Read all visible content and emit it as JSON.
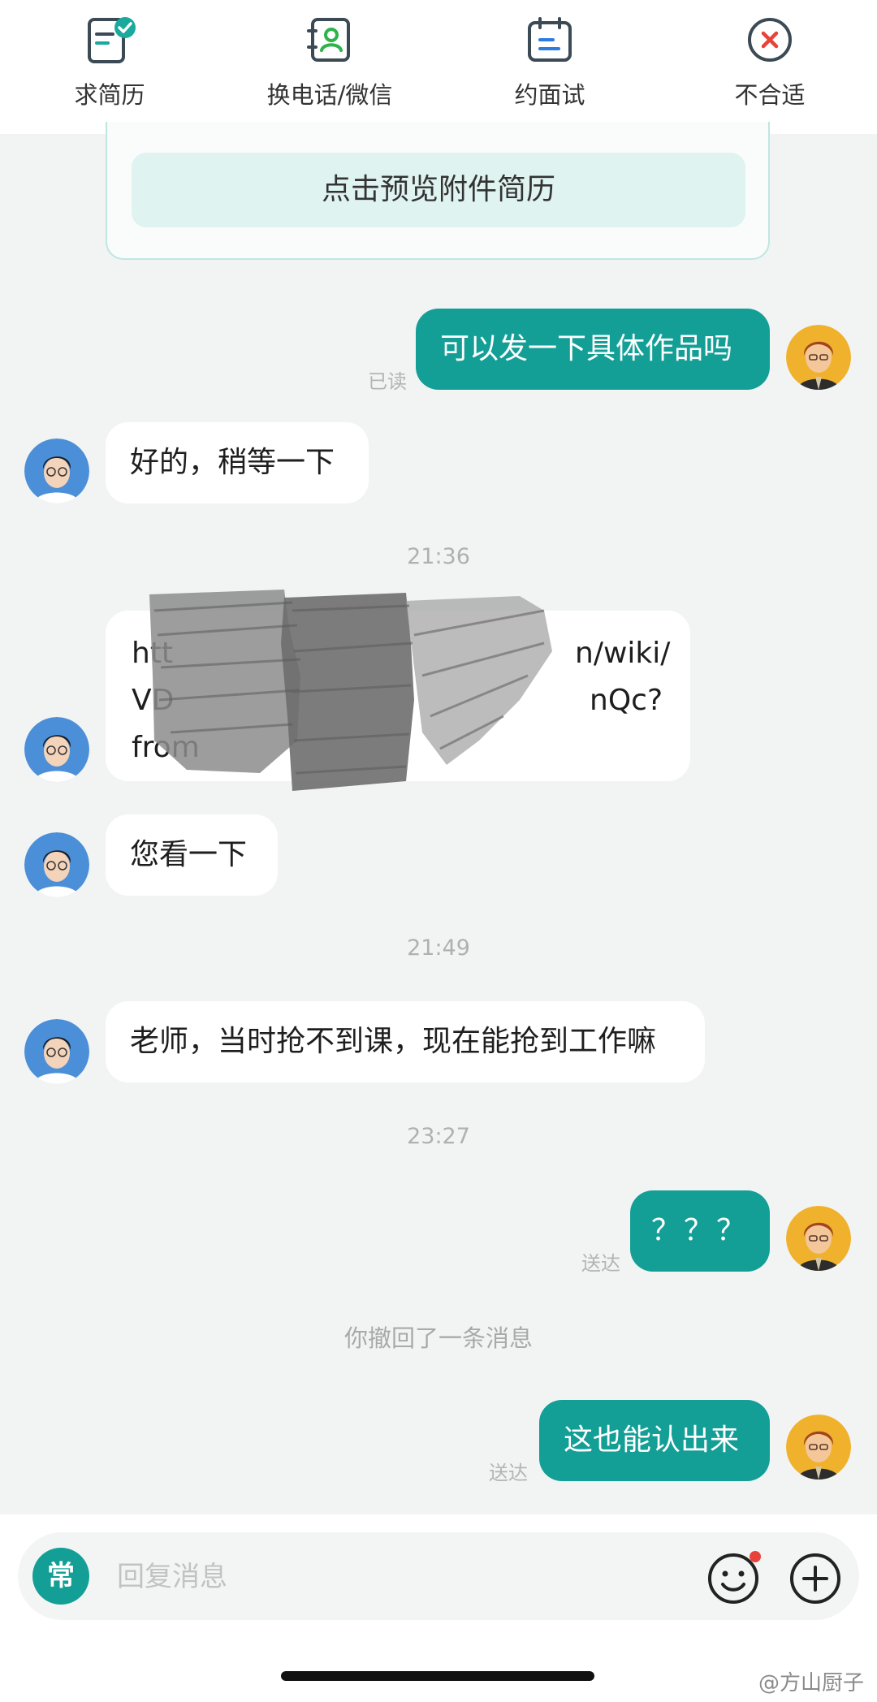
{
  "actions": [
    {
      "label": "求简历",
      "icon": "resume-check-icon"
    },
    {
      "label": "换电话/微信",
      "icon": "contact-book-icon"
    },
    {
      "label": "约面试",
      "icon": "calendar-icon"
    },
    {
      "label": "不合适",
      "icon": "close-circle-icon"
    }
  ],
  "resume": {
    "preview_label": "点击预览附件简历"
  },
  "messages": {
    "m1": {
      "text": "可以发一下具体作品吗",
      "status": "已读"
    },
    "m2": {
      "text": "好的，稍等一下"
    },
    "t1": "21:36",
    "link": {
      "line1a": "htt",
      "line1b": "n/wiki/",
      "line2a": "VD",
      "line2b": "nQc?",
      "line3a": "from"
    },
    "m4": {
      "text": "您看一下"
    },
    "t2": "21:49",
    "m5": {
      "text": "老师，当时抢不到课，现在能抢到工作嘛"
    },
    "t3": "23:27",
    "m6": {
      "text": "？？？",
      "status": "送达"
    },
    "recall": "你撤回了一条消息",
    "m7": {
      "text": "这也能认出来",
      "status": "送达"
    }
  },
  "input": {
    "common_label": "常",
    "placeholder": "回复消息"
  },
  "watermark": "@方山厨子",
  "colors": {
    "accent": "#139f96",
    "notify_dot": "#e8433a"
  }
}
